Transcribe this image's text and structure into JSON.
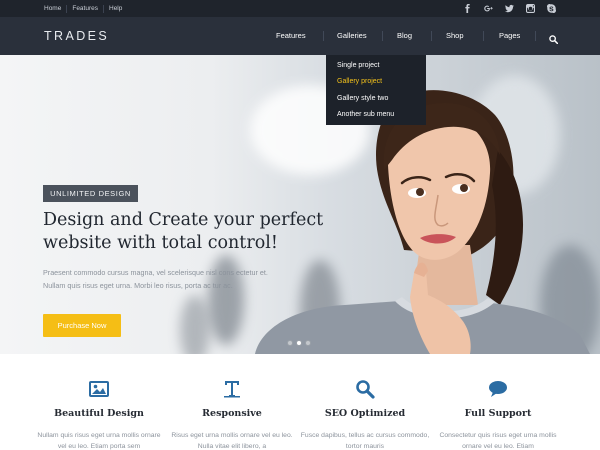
{
  "topbar": {
    "links": [
      "Home",
      "Features",
      "Help"
    ],
    "socials": [
      "facebook-icon",
      "google-plus-icon",
      "twitter-icon",
      "instagram-icon",
      "skype-icon"
    ]
  },
  "header": {
    "logo": "TRADES",
    "nav": [
      "Features",
      "Galleries",
      "Blog",
      "Shop",
      "Pages"
    ],
    "search_icon": "search-icon"
  },
  "dropdown": {
    "items": [
      "Single project",
      "Gallery project",
      "Gallery style two",
      "Another sub menu"
    ],
    "active_index": 1
  },
  "hero": {
    "badge": "UNLIMITED DESIGN",
    "title_line1": "Design and Create your perfect",
    "title_line2": "website with total control!",
    "text_line1": "Praesent commodo cursus magna, vel scelerisque nisl cons ectetur et.",
    "text_line2": "Nullam quis risus eget urna. Morbi leo risus, porta ac tur ac.",
    "cta": "Purchase Now",
    "slides": 3,
    "active_slide": 1
  },
  "features": [
    {
      "icon": "image-icon",
      "title": "Beautiful Design",
      "text": "Nullam quis risus eget urna mollis ornare vel eu leo. Etiam porta sem"
    },
    {
      "icon": "typography-icon",
      "title": "Responsive",
      "text": "Risus eget urna mollis ornare vel eu leo. Nulla vitae elit libero, a"
    },
    {
      "icon": "search-icon",
      "title": "SEO Optimized",
      "text": "Fusce dapibus, tellus ac cursus commodo, tortor mauris"
    },
    {
      "icon": "chat-icon",
      "title": "Full Support",
      "text": "Consectetur quis risus eget urna mollis ornare vel eu leo. Etiam"
    }
  ],
  "colors": {
    "accent": "#f5be15",
    "topbar": "#1f242c",
    "navbar": "#2a303b",
    "icon_blue": "#2b6ca3",
    "dropdown_active": "#f4c21b"
  }
}
